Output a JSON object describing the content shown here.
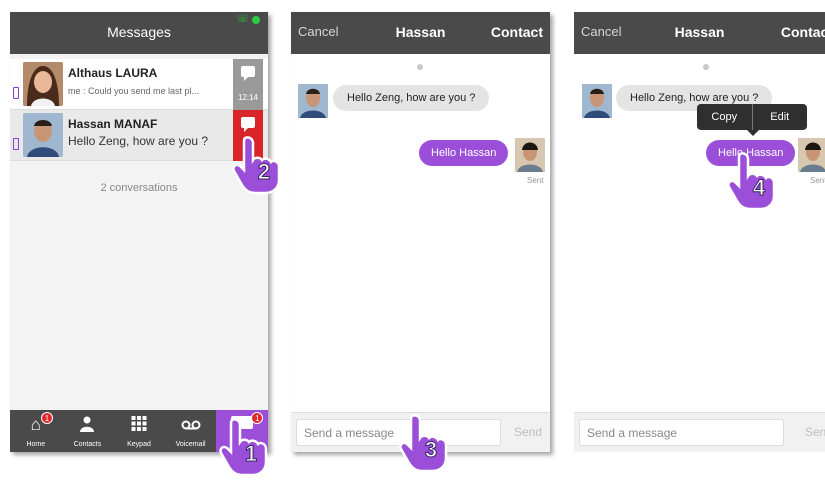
{
  "screen1": {
    "title": "Messages",
    "conversations": [
      {
        "name": "Althaus LAURA",
        "preview": "me : Could you send me last pl...",
        "time": "12:14",
        "selected": false
      },
      {
        "name": "Hassan MANAF",
        "preview": "Hello Zeng, how are you ?",
        "time": "",
        "selected": true
      }
    ],
    "count_label": "2 conversations",
    "nav": [
      {
        "label": "Home",
        "icon": "home-icon",
        "badge": "1"
      },
      {
        "label": "Contacts",
        "icon": "person-icon",
        "badge": ""
      },
      {
        "label": "Keypad",
        "icon": "keypad-icon",
        "badge": ""
      },
      {
        "label": "Voicemail",
        "icon": "voicemail-icon",
        "badge": ""
      },
      {
        "label": "",
        "icon": "chat-icon",
        "badge": "1"
      }
    ]
  },
  "screen2": {
    "cancel": "Cancel",
    "title": "Hassan",
    "contact": "Contact",
    "incoming": "Hello Zeng, how are you ?",
    "outgoing": "Hello Hassan",
    "sent_label": "Sent",
    "input_placeholder": "Send a message",
    "send_label": "Send"
  },
  "screen3": {
    "cancel": "Cancel",
    "title": "Hassan",
    "contact": "Contact",
    "incoming": "Hello Zeng, how are you ?",
    "outgoing": "Hello Hassan",
    "sent_label": "Sent",
    "popup_copy": "Copy",
    "popup_edit": "Edit",
    "input_placeholder": "Send a message",
    "send_label": "Send"
  },
  "steps": [
    "1",
    "2",
    "3",
    "4"
  ],
  "colors": {
    "accent": "#9b4fd8",
    "header": "#4a4a4a",
    "alert": "#d8252a",
    "bubble_in": "#e4e4e4"
  }
}
